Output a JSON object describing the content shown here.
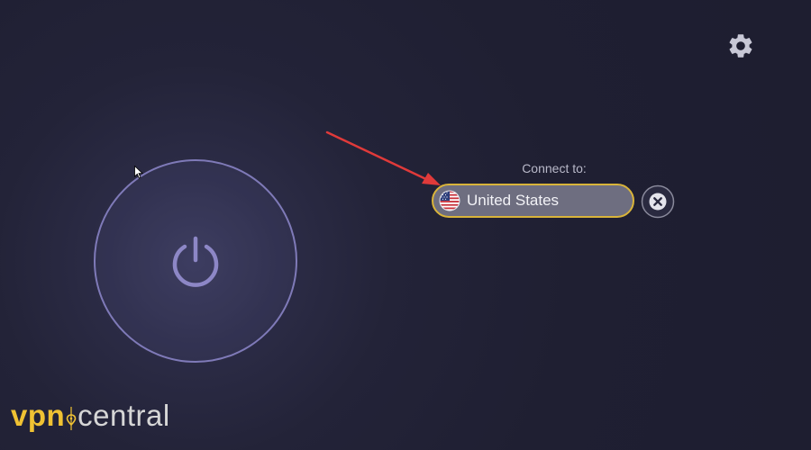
{
  "settings": {
    "icon": "gear-icon"
  },
  "power": {
    "icon": "power-icon"
  },
  "connect": {
    "label": "Connect to:",
    "location": "United States",
    "flag_icon": "us-flag-icon",
    "clear_icon": "close-circle-icon"
  },
  "brand": {
    "vpn": "vpn",
    "central": "central"
  },
  "colors": {
    "accent_yellow": "#d9b43a",
    "power_ring": "#7f7ab8",
    "annotation_arrow": "#e03a3a",
    "background": "#1f1f32"
  }
}
